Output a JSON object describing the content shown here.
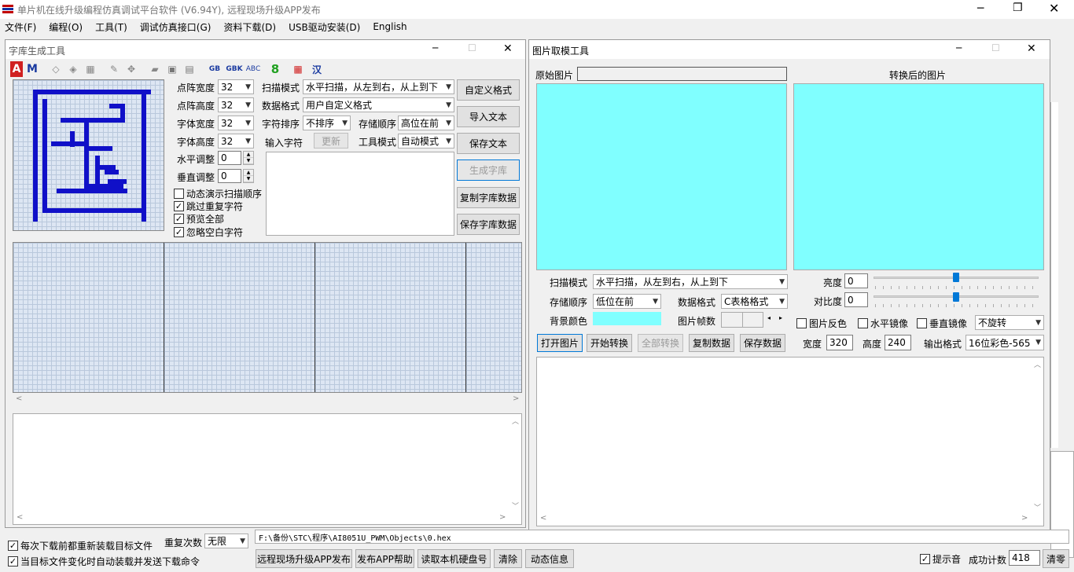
{
  "app": {
    "title": "单片机在线升级编程仿真调试平台软件 (V6.94Y), 远程现场升级APP发布",
    "menu": [
      "文件(F)",
      "编程(O)",
      "工具(T)",
      "调试仿真接口(G)",
      "资料下载(D)",
      "USB驱动安装(D)",
      "English"
    ]
  },
  "font_tool": {
    "title": "字库生成工具",
    "toolbar": [
      "A",
      "M",
      "GB",
      "GBK",
      "ABC",
      "8",
      "汉"
    ],
    "dot_width_label": "点阵宽度",
    "dot_width": "32",
    "dot_height_label": "点阵高度",
    "dot_height": "32",
    "font_width_label": "字体宽度",
    "font_width": "32",
    "font_height_label": "字体高度",
    "font_height": "32",
    "h_adjust_label": "水平调整",
    "h_adjust": "0",
    "v_adjust_label": "垂直调整",
    "v_adjust": "0",
    "scan_mode_label": "扫描模式",
    "scan_mode": "水平扫描，从左到右，从上到下",
    "data_format_label": "数据格式",
    "data_format": "用户自定义格式",
    "char_sort_label": "字符排序",
    "char_sort": "不排序",
    "storage_order_label": "存储顺序",
    "storage_order": "高位在前",
    "input_char_label": "输入字符",
    "update_button": "更新",
    "tool_mode_label": "工具模式",
    "tool_mode": "自动模式",
    "checkboxes": [
      {
        "label": "动态演示扫描顺序",
        "checked": false
      },
      {
        "label": "跳过重复字符",
        "checked": true
      },
      {
        "label": "预览全部",
        "checked": true
      },
      {
        "label": "忽略空白字符",
        "checked": true
      }
    ],
    "buttons": [
      "自定义格式",
      "导入文本",
      "保存文本",
      "生成字库",
      "复制字库数据",
      "保存字库数据"
    ]
  },
  "image_tool": {
    "title": "图片取模工具",
    "original_label": "原始图片",
    "converted_label": "转换后的图片",
    "scan_mode_label": "扫描模式",
    "scan_mode": "水平扫描，从左到右，从上到下",
    "storage_order_label": "存储顺序",
    "storage_order": "低位在前",
    "data_format_label": "数据格式",
    "data_format": "C表格格式",
    "bg_color_label": "背景颜色",
    "frame_count_label": "图片帧数",
    "brightness_label": "亮度",
    "brightness": "0",
    "contrast_label": "对比度",
    "contrast": "0",
    "checkboxes": [
      {
        "label": "图片反色",
        "checked": false
      },
      {
        "label": "水平镜像",
        "checked": false
      },
      {
        "label": "垂直镜像",
        "checked": false
      }
    ],
    "rotate": "不旋转",
    "buttons": [
      "打开图片",
      "开始转换",
      "全部转换",
      "复制数据",
      "保存数据"
    ],
    "width_label": "宽度",
    "width": "320",
    "height_label": "高度",
    "height": "240",
    "output_format_label": "输出格式",
    "output_format": "16位彩色-565",
    "preview_color": "#80ffff"
  },
  "bottom": {
    "chk_reload": "每次下载前都重新装载目标文件",
    "chk_auto": "当目标文件变化时自动装载并发送下载命令",
    "repeat_label": "重复次数",
    "repeat_value": "无限",
    "file_path": "F:\\备份\\STC\\程序\\AI8051U_PWM\\Objects\\0.hex",
    "buttons": [
      "远程现场升级APP发布",
      "发布APP帮助",
      "读取本机硬盘号",
      "清除",
      "动态信息"
    ],
    "chk_sound": "提示音",
    "success_label": "成功计数",
    "success_count": "418",
    "clear_button": "清零"
  }
}
